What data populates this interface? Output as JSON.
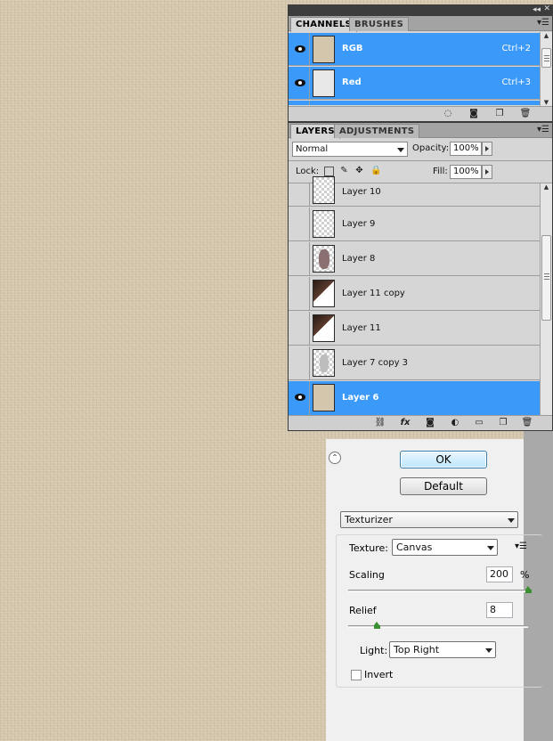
{
  "channels_panel": {
    "tabs": [
      "CHANNELS",
      "BRUSHES"
    ],
    "rows": [
      {
        "label": "RGB",
        "shortcut": "Ctrl+2"
      },
      {
        "label": "Red",
        "shortcut": "Ctrl+3"
      }
    ]
  },
  "layers_panel": {
    "tabs": [
      "LAYERS",
      "ADJUSTMENTS"
    ],
    "blend_mode": "Normal",
    "opacity_label": "Opacity:",
    "opacity_value": "100%",
    "lock_label": "Lock:",
    "fill_label": "Fill:",
    "fill_value": "100%",
    "layers": [
      {
        "name": "Layer 10",
        "visible": false,
        "selected": false
      },
      {
        "name": "Layer 9",
        "visible": false,
        "selected": false
      },
      {
        "name": "Layer 8",
        "visible": false,
        "selected": false
      },
      {
        "name": "Layer 11 copy",
        "visible": false,
        "selected": false
      },
      {
        "name": "Layer 11",
        "visible": false,
        "selected": false
      },
      {
        "name": "Layer 7 copy 3",
        "visible": false,
        "selected": false
      },
      {
        "name": "Layer 6",
        "visible": true,
        "selected": true
      }
    ]
  },
  "filter_dialog": {
    "ok_label": "OK",
    "default_label": "Default",
    "filter_name": "Texturizer",
    "texture_label": "Texture:",
    "texture_value": "Canvas",
    "scaling_label": "Scaling",
    "scaling_value": "200",
    "scaling_unit": "%",
    "scaling_fraction": 1.0,
    "relief_label": "Relief",
    "relief_value": "8",
    "relief_fraction": 0.16,
    "light_label": "Light:",
    "light_value": "Top Right",
    "invert_label": "Invert",
    "invert_checked": false
  },
  "colors": {
    "selection_blue": "#3a99f9",
    "panel_gray": "#d6d6d6",
    "canvas_tan": "#d4c6ad"
  }
}
